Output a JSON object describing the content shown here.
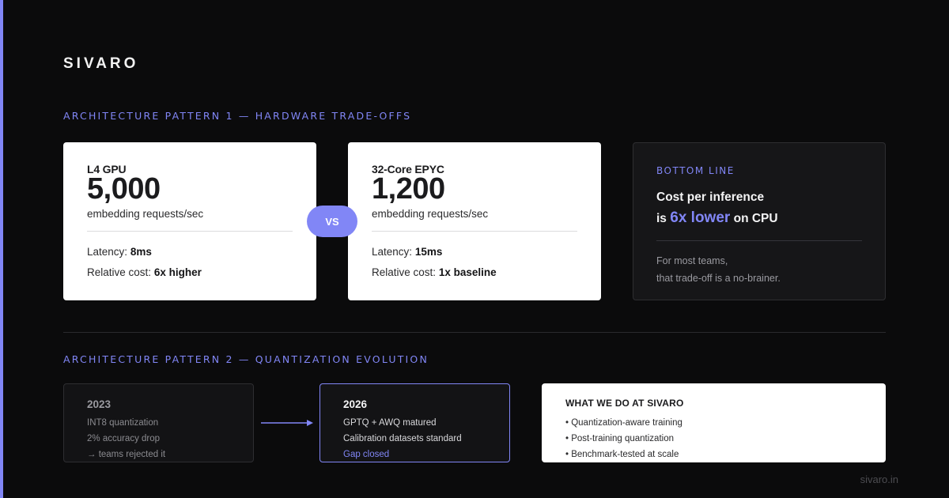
{
  "brand": "SIVARO",
  "section1_label": "ARCHITECTURE PATTERN 1 — HARDWARE TRADE-OFFS",
  "gpu": {
    "name": "L4 GPU",
    "value": "5,000",
    "unit": "embedding requests/sec",
    "latency_label": "Latency:",
    "latency_value": "8ms",
    "cost_label": "Relative cost:",
    "cost_value": "6x higher"
  },
  "vs_label": "VS",
  "cpu": {
    "name": "32-Core EPYC",
    "value": "1,200",
    "unit": "embedding requests/sec",
    "latency_label": "Latency:",
    "latency_value": "15ms",
    "cost_label": "Relative cost:",
    "cost_value": "1x baseline"
  },
  "bottom_line": {
    "label": "BOTTOM LINE",
    "line1": "Cost per inference",
    "line2_prefix": "is",
    "highlight": "6x lower",
    "line2_suffix": "on CPU",
    "note1": "For most teams,",
    "note2": "that trade-off is a no-brainer."
  },
  "section2_label": "ARCHITECTURE PATTERN 2 — QUANTIZATION EVOLUTION",
  "era_past": {
    "year": "2023",
    "lines": [
      "INT8 quantization",
      "2% accuracy drop",
      "→ teams rejected it"
    ]
  },
  "era_now": {
    "year": "2026",
    "lines": [
      "GPTQ + AWQ matured",
      "Calibration datasets standard",
      "Gap closed"
    ]
  },
  "what_we_do": {
    "title": "WHAT WE DO AT SIVARO",
    "items": [
      "• Quantization-aware training",
      "• Post-training quantization",
      "• Benchmark-tested at scale"
    ]
  },
  "footer": "sivaro.in",
  "colors": {
    "accent": "#8186f6",
    "background": "#0b0b0c",
    "card_light": "#ffffff",
    "card_dark": "#161618"
  },
  "icons": {
    "arrow": "arrow-right-icon"
  }
}
